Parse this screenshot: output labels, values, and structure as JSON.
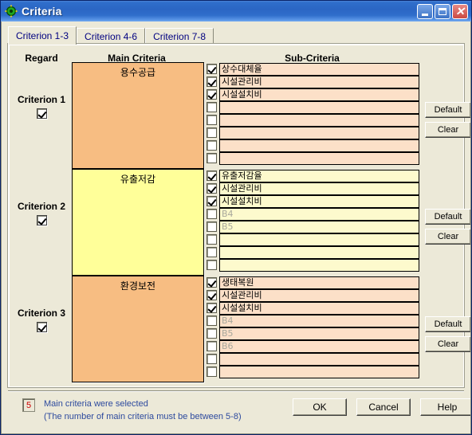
{
  "window": {
    "title": "Criteria",
    "icon": "app-icon",
    "buttons": {
      "minimize": "_",
      "maximize": "□",
      "close": "✕"
    }
  },
  "tabs": [
    {
      "label": "Criterion 1-3",
      "active": true
    },
    {
      "label": "Criterion 4-6",
      "active": false
    },
    {
      "label": "Criterion 7-8",
      "active": false
    }
  ],
  "headers": {
    "regard": "Regard",
    "main_criteria": "Main Criteria",
    "sub_criteria": "Sub-Criteria"
  },
  "colors": {
    "group1_fill": "#f7bd82",
    "group1_sub_fill": "#fce0c8",
    "group2_fill": "#ffff99",
    "group2_sub_fill": "#fdfacd",
    "group3_fill": "#f7bd82",
    "group3_sub_fill": "#fce0c8",
    "title_accent": "#2b66c4",
    "status_text": "#2d4a9e",
    "status_count": "#cc0000"
  },
  "groups": [
    {
      "criterion_label": "Criterion 1",
      "criterion_checked": true,
      "main_criteria_text": "용수공급",
      "default_button": "Default",
      "clear_button": "Clear",
      "sub_criteria": [
        {
          "label": "상수대체율",
          "checked": true,
          "disabled": false
        },
        {
          "label": "시설관리비",
          "checked": true,
          "disabled": false
        },
        {
          "label": "시설설치비",
          "checked": true,
          "disabled": false
        },
        {
          "label": "",
          "checked": false,
          "disabled": false
        },
        {
          "label": "",
          "checked": false,
          "disabled": false
        },
        {
          "label": "",
          "checked": false,
          "disabled": false
        },
        {
          "label": "",
          "checked": false,
          "disabled": false
        },
        {
          "label": "",
          "checked": false,
          "disabled": false
        }
      ]
    },
    {
      "criterion_label": "Criterion 2",
      "criterion_checked": true,
      "main_criteria_text": "유출저감",
      "default_button": "Default",
      "clear_button": "Clear",
      "sub_criteria": [
        {
          "label": "유출저감율",
          "checked": true,
          "disabled": false
        },
        {
          "label": "시설관리비",
          "checked": true,
          "disabled": false
        },
        {
          "label": "시설설치비",
          "checked": true,
          "disabled": false
        },
        {
          "label": "B4",
          "checked": false,
          "disabled": true
        },
        {
          "label": "B5",
          "checked": false,
          "disabled": true
        },
        {
          "label": "",
          "checked": false,
          "disabled": false
        },
        {
          "label": "",
          "checked": false,
          "disabled": false
        },
        {
          "label": "",
          "checked": false,
          "disabled": false
        }
      ]
    },
    {
      "criterion_label": "Criterion 3",
      "criterion_checked": true,
      "main_criteria_text": "환경보전",
      "default_button": "Default",
      "clear_button": "Clear",
      "sub_criteria": [
        {
          "label": "생태복원",
          "checked": true,
          "disabled": false
        },
        {
          "label": "시설관리비",
          "checked": true,
          "disabled": false
        },
        {
          "label": "시설설치비",
          "checked": true,
          "disabled": false
        },
        {
          "label": "B4",
          "checked": false,
          "disabled": true
        },
        {
          "label": "B5",
          "checked": false,
          "disabled": true
        },
        {
          "label": "B6",
          "checked": false,
          "disabled": true
        },
        {
          "label": "",
          "checked": false,
          "disabled": false
        },
        {
          "label": "",
          "checked": false,
          "disabled": false
        }
      ]
    }
  ],
  "status": {
    "count": "5",
    "message_line1": "Main criteria were selected",
    "message_line2": "(The number of main criteria must be between 5-8)"
  },
  "footer_buttons": {
    "ok": "OK",
    "cancel": "Cancel",
    "help": "Help"
  }
}
